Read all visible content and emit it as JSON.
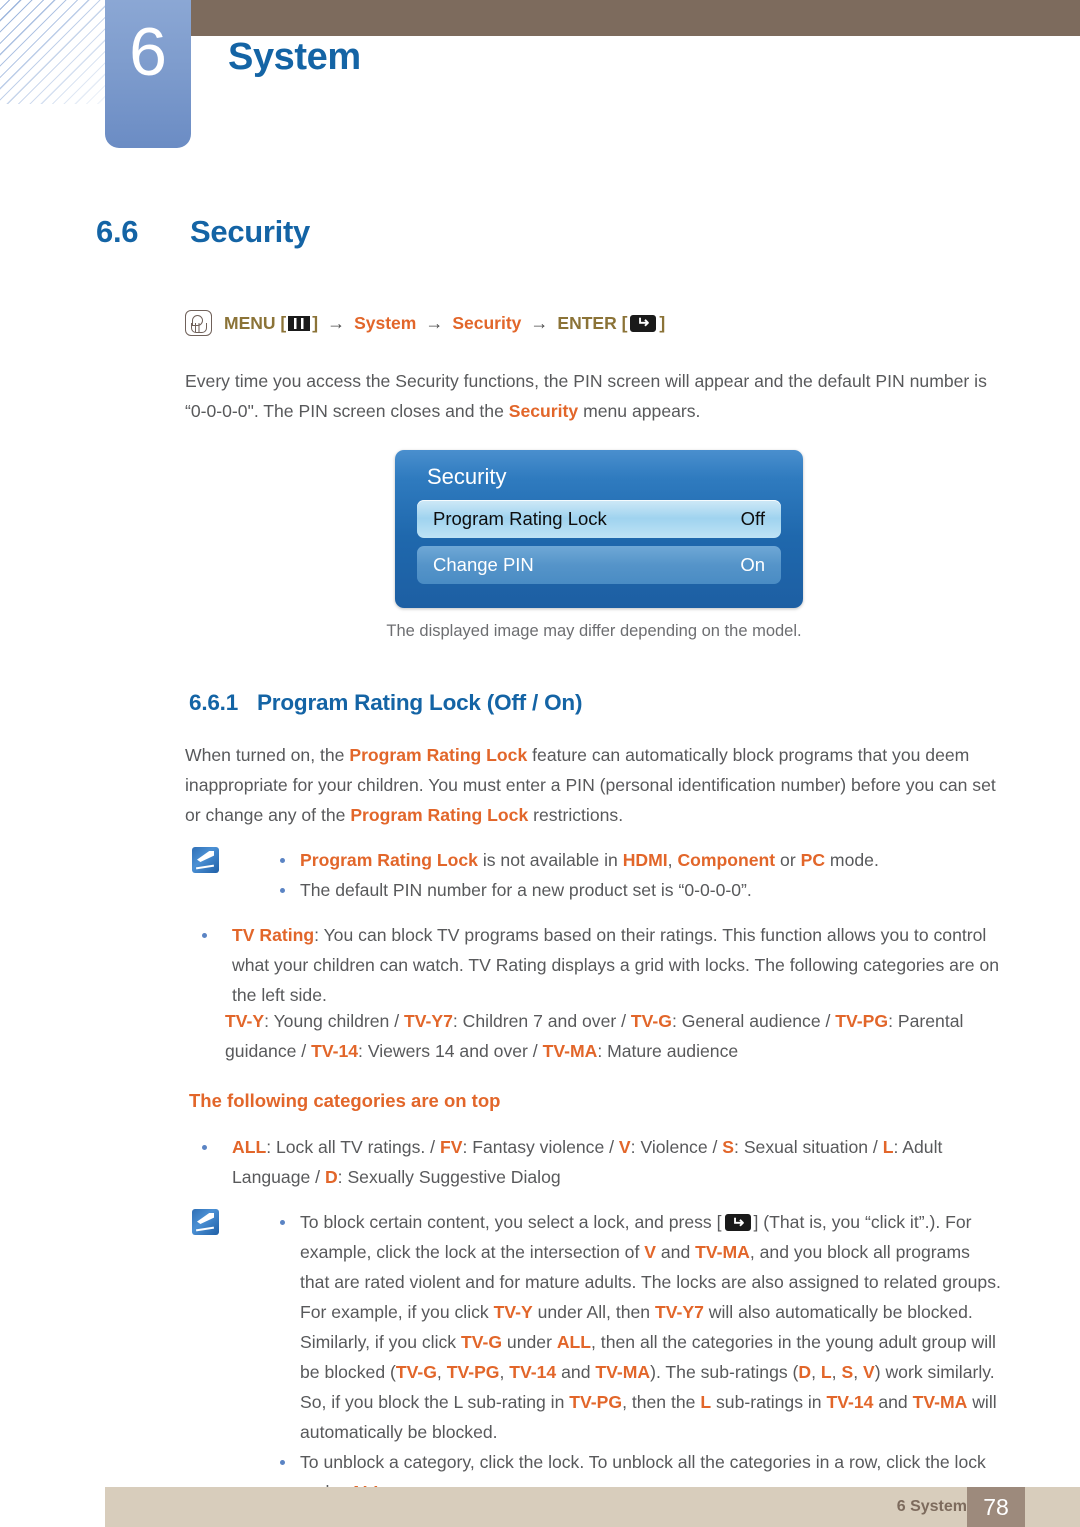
{
  "header": {
    "chapter_number": "6",
    "chapter_title": "System"
  },
  "section": {
    "number": "6.6",
    "title": "Security"
  },
  "nav_path": {
    "hand_icon": "hand-press-icon",
    "menu_label": "MENU",
    "menu_icon": "menu-button-icon",
    "arrow": "→",
    "step_system": "System",
    "step_security": "Security",
    "enter_label": "ENTER",
    "enter_icon": "enter-key-icon",
    "bracket_open": "[",
    "bracket_close": "]"
  },
  "intro": {
    "line_a": "Every time you access the Security functions, the PIN screen will appear and the default PIN number is “0-0-0-0\". The PIN screen closes and the ",
    "highlight": "Security",
    "line_b": " menu appears."
  },
  "osd": {
    "title": "Security",
    "rows": [
      {
        "label": "Program Rating Lock",
        "value": "Off",
        "selected": true
      },
      {
        "label": "Change PIN",
        "value": "On",
        "selected": false
      }
    ],
    "caption": "The displayed image may differ depending on the model."
  },
  "subsection": {
    "number": "6.6.1",
    "title": "Program Rating Lock (Off / On)"
  },
  "prl_paragraph": {
    "a": "When turned on, the ",
    "b1": "Program Rating Lock",
    "c": " feature can automatically block programs that you deem inappropriate for your children. You must enter a PIN (personal identification number) before you can set or change any of the ",
    "b2": "Program Rating Lock",
    "d": " restrictions."
  },
  "note_1": {
    "icon": "note-pencil-icon",
    "items": [
      {
        "a": "",
        "b1": "Program Rating Lock",
        "c": " is not available in ",
        "b2": "HDMI",
        "d": ", ",
        "b3": "Component",
        "e": " or ",
        "b4": "PC",
        "f": " mode."
      },
      {
        "text": "The default PIN number for a new product set is “0-0-0-0”."
      }
    ]
  },
  "tv_rating": {
    "term": "TV Rating",
    "body": ": You can block TV programs based on their ratings. This function allows you to control what your children can watch. TV Rating displays a grid with locks. The following categories are on the left side."
  },
  "rating_legend": {
    "items": [
      {
        "code": "TV-Y",
        "desc": ": Young children"
      },
      {
        "code": "TV-Y7",
        "desc": ": Children 7 and over"
      },
      {
        "code": "TV-G",
        "desc": ": General audience"
      },
      {
        "code": "TV-PG",
        "desc": ": Parental guidance"
      },
      {
        "code": "TV-14",
        "desc": ": Viewers 14 and over"
      },
      {
        "code": "TV-MA",
        "desc": ": Mature audience"
      }
    ],
    "separator": " / "
  },
  "categories_heading": "The following categories are on top",
  "categories_bullet": {
    "items": [
      {
        "code": "ALL",
        "desc": ": Lock all TV ratings."
      },
      {
        "code": "FV",
        "desc": ": Fantasy violence"
      },
      {
        "code": "V",
        "desc": ": Violence"
      },
      {
        "code": "S",
        "desc": ": Sexual situation"
      },
      {
        "code": "L",
        "desc": ": Adult Language"
      },
      {
        "code": "D",
        "desc": ": Sexually Suggestive Dialog"
      }
    ],
    "separator": " / "
  },
  "note_2": {
    "icon": "note-pencil-icon",
    "item1": {
      "s1": "To block certain content, you select a lock, and press [",
      "enter_icon": "enter-key-icon",
      "s2": "] (That is, you “click it”.). For example, click the lock at the intersection of ",
      "k1": "V",
      "s3": " and ",
      "k2": "TV-MA",
      "s4": ", and you block all programs that are rated violent and for mature adults. The locks are also assigned to related groups. For example, if you click ",
      "k3": "TV-Y",
      "s5": " under All, then ",
      "k4": "TV-Y7",
      "s6": " will also automatically be blocked. Similarly, if you click ",
      "k5": "TV-G",
      "s7": " under ",
      "k6": "ALL",
      "s8": ", then all the categories in the young adult group will be blocked (",
      "k7": "TV-G",
      "s9": ", ",
      "k8": "TV-PG",
      "s10": ", ",
      "k9": "TV-14",
      "s11": " and ",
      "k10": "TV-MA",
      "s12": "). The sub-ratings (",
      "k11": "D",
      "s13": ", ",
      "k12": "L",
      "s14": ", ",
      "k13": "S",
      "s15": ", ",
      "k14": "V",
      "s16": ") work similarly. So, if you block the L sub-rating in ",
      "k15": "TV-PG",
      "s17": ", then the ",
      "k16": "L",
      "s18": " sub-ratings in ",
      "k17": "TV-14",
      "s19": " and ",
      "k18": "TV-MA",
      "s20": " will automatically be blocked."
    },
    "item2": {
      "s1": "To unblock a category, click the lock. To unblock all the categories in a row, click the lock under ",
      "k1": "ALL",
      "s2": "."
    }
  },
  "footer": {
    "label": "6 System",
    "page_number": "78"
  },
  "colors": {
    "heading_blue": "#1464a5",
    "accent_orange": "#e2662a",
    "menu_gold": "#8b7337",
    "body_gray": "#58595b",
    "footer_beige": "#d8cdbc",
    "footer_brown": "#9d8a7c",
    "header_brown": "#7d6b5d",
    "tab_blue": "#7e9ccd"
  }
}
